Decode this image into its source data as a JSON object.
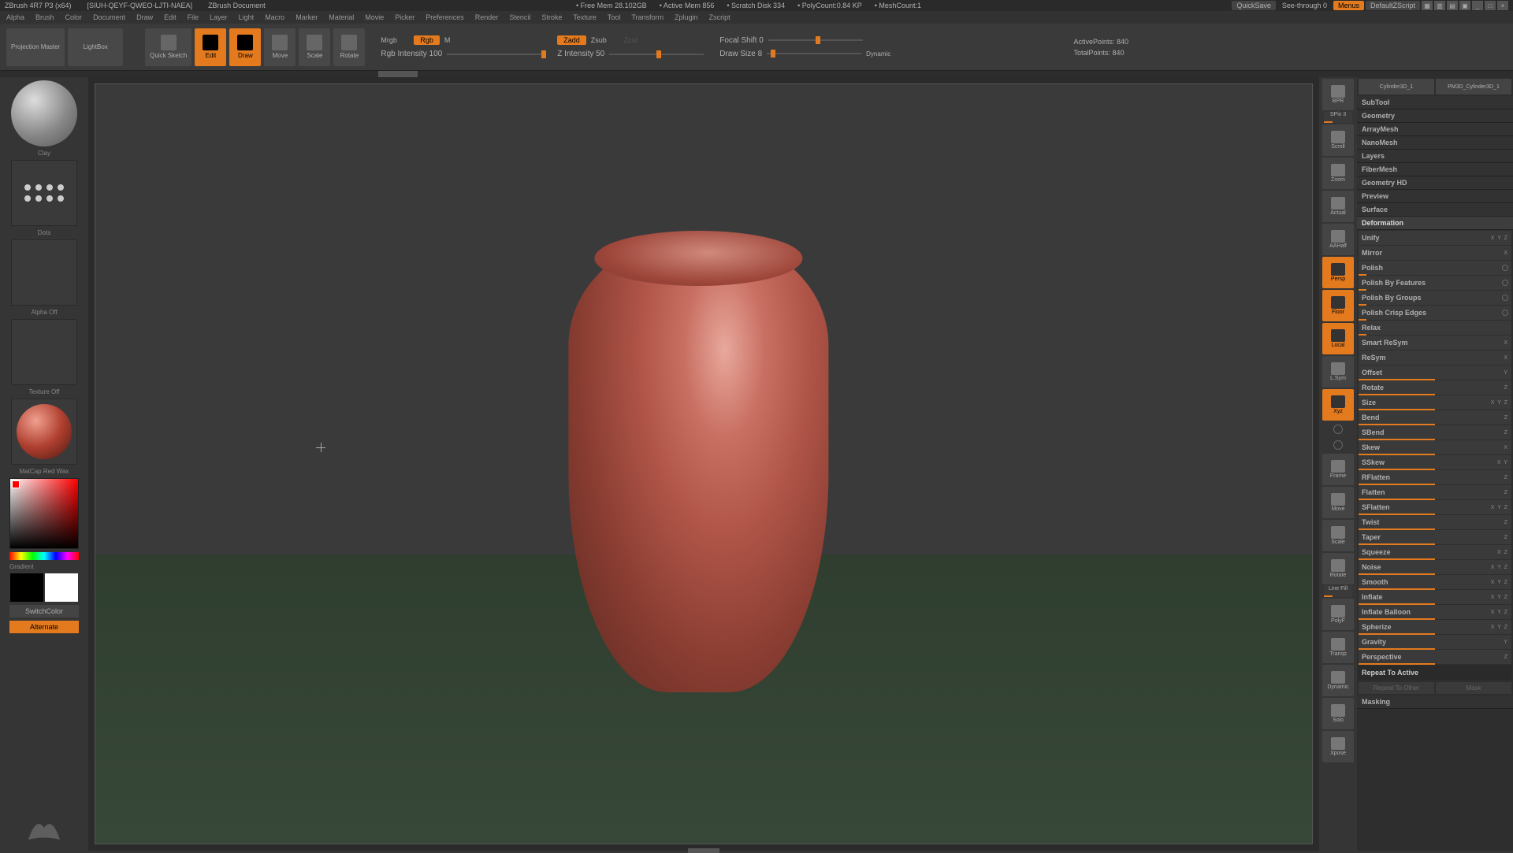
{
  "titlebar": {
    "app": "ZBrush 4R7 P3 (x64)",
    "doc_id": "[SIUH-QEYF-QWEO-LJTI-NAEA]",
    "doc": "ZBrush Document",
    "stats": {
      "free_mem": "• Free Mem 28.102GB",
      "active_mem": "• Active Mem 856",
      "scratch": "• Scratch Disk 334",
      "polycount": "• PolyCount:0.84 KP",
      "meshcount": "• MeshCount:1"
    },
    "quicksave": "QuickSave",
    "seethrough": "See-through  0",
    "menus": "Menus",
    "layout": "DefaultZScript"
  },
  "menubar": [
    "Alpha",
    "Brush",
    "Color",
    "Document",
    "Draw",
    "Edit",
    "File",
    "Layer",
    "Light",
    "Macro",
    "Marker",
    "Material",
    "Movie",
    "Picker",
    "Preferences",
    "Render",
    "Stencil",
    "Stroke",
    "Texture",
    "Tool",
    "Transform",
    "Zplugin",
    "Zscript"
  ],
  "toolbar": {
    "projection": "Projection\nMaster",
    "lightbox": "LightBox",
    "quicksketch": "Quick\nSketch",
    "edit": "Edit",
    "draw": "Draw",
    "move": "Move",
    "scale": "Scale",
    "rotate": "Rotate",
    "mrgb": "Mrgb",
    "rgb": "Rgb",
    "m": "M",
    "rgb_intensity": "Rgb Intensity 100",
    "zadd": "Zadd",
    "zsub": "Zsub",
    "zcut": "Zcut",
    "z_intensity": "Z Intensity 50",
    "focal_shift": "Focal Shift 0",
    "draw_size": "Draw Size 8",
    "dynamic": "Dynamic",
    "active_points": "ActivePoints: 840",
    "total_points": "TotalPoints: 840"
  },
  "left": {
    "clay": "Clay",
    "dots": "Dots",
    "alpha": "Alpha Off",
    "texture": "Texture Off",
    "matcap": "MatCap Red Wax",
    "gradient": "Gradient",
    "switch": "SwitchColor",
    "alternate": "Alternate"
  },
  "right_toolbar": {
    "bpr": "BPR",
    "spix": "SPix 3",
    "scroll": "Scroll",
    "zoom": "Zoom",
    "actual": "Actual",
    "aahalf": "AAHalf",
    "persp": "Persp",
    "floor": "Floor",
    "local": "Local",
    "lsym": "L.Sym",
    "xyz": "Xyz",
    "frame": "Frame",
    "move": "Move",
    "scale": "Scale",
    "rotate": "Rotate",
    "linefill": "Line Fill",
    "polyf": "PolyF",
    "transp": "Transp",
    "dynamic": "Dynamic",
    "solo": "Solo",
    "xpose": "Xpose"
  },
  "right_panel": {
    "header1": "Cylinder3D_1",
    "header2": "PM3D_Cylinder3D_1",
    "sections": [
      "SubTool",
      "Geometry",
      "ArrayMesh",
      "NanoMesh",
      "Layers",
      "FiberMesh",
      "Geometry HD",
      "Preview",
      "Surface"
    ],
    "deformation": "Deformation",
    "items": [
      {
        "label": "Unify",
        "axes": "X Y Z",
        "slider": 0
      },
      {
        "label": "Mirror",
        "axes": "X",
        "slider": 0
      },
      {
        "label": "Polish",
        "axes": "",
        "dot": true,
        "slider": 5
      },
      {
        "label": "Polish By Features",
        "axes": "",
        "dot": true,
        "slider": 5
      },
      {
        "label": "Polish By Groups",
        "axes": "",
        "dot": true,
        "slider": 5
      },
      {
        "label": "Polish Crisp Edges",
        "axes": "",
        "dot": true,
        "slider": 5
      },
      {
        "label": "Relax",
        "axes": "",
        "slider": 5
      },
      {
        "label": "Smart ReSym",
        "axes": "X",
        "slider": 0
      },
      {
        "label": "ReSym",
        "axes": "X",
        "slider": 0
      },
      {
        "label": "Offset",
        "axes": "Y",
        "slider": 50
      },
      {
        "label": "Rotate",
        "axes": "Z",
        "slider": 50
      },
      {
        "label": "Size",
        "axes": "X Y Z",
        "slider": 50
      },
      {
        "label": "Bend",
        "axes": "Z",
        "slider": 50
      },
      {
        "label": "SBend",
        "axes": "Z",
        "slider": 50
      },
      {
        "label": "Skew",
        "axes": "X",
        "slider": 50
      },
      {
        "label": "SSkew",
        "axes": "X Y",
        "slider": 50
      },
      {
        "label": "RFlatten",
        "axes": "Z",
        "slider": 50
      },
      {
        "label": "Flatten",
        "axes": "Z",
        "slider": 50
      },
      {
        "label": "SFlatten",
        "axes": "X Y Z",
        "slider": 50
      },
      {
        "label": "Twist",
        "axes": "Z",
        "slider": 50
      },
      {
        "label": "Taper",
        "axes": "Z",
        "slider": 50
      },
      {
        "label": "Squeeze",
        "axes": "X  Z",
        "slider": 50
      },
      {
        "label": "Noise",
        "axes": "X Y Z",
        "slider": 50
      },
      {
        "label": "Smooth",
        "axes": "X Y Z",
        "slider": 50
      },
      {
        "label": "Inflate",
        "axes": "X Y Z",
        "slider": 50
      },
      {
        "label": "Inflate Balloon",
        "axes": "X Y Z",
        "slider": 50
      },
      {
        "label": "Spherize",
        "axes": "X Y Z",
        "slider": 50
      },
      {
        "label": "Gravity",
        "axes": "Y",
        "slider": 50
      },
      {
        "label": "Perspective",
        "axes": "Z",
        "slider": 50
      }
    ],
    "repeat_active": "Repeat To Active",
    "repeat_other": "Repeat To Other",
    "mask": "Mask",
    "masking": "Masking"
  }
}
